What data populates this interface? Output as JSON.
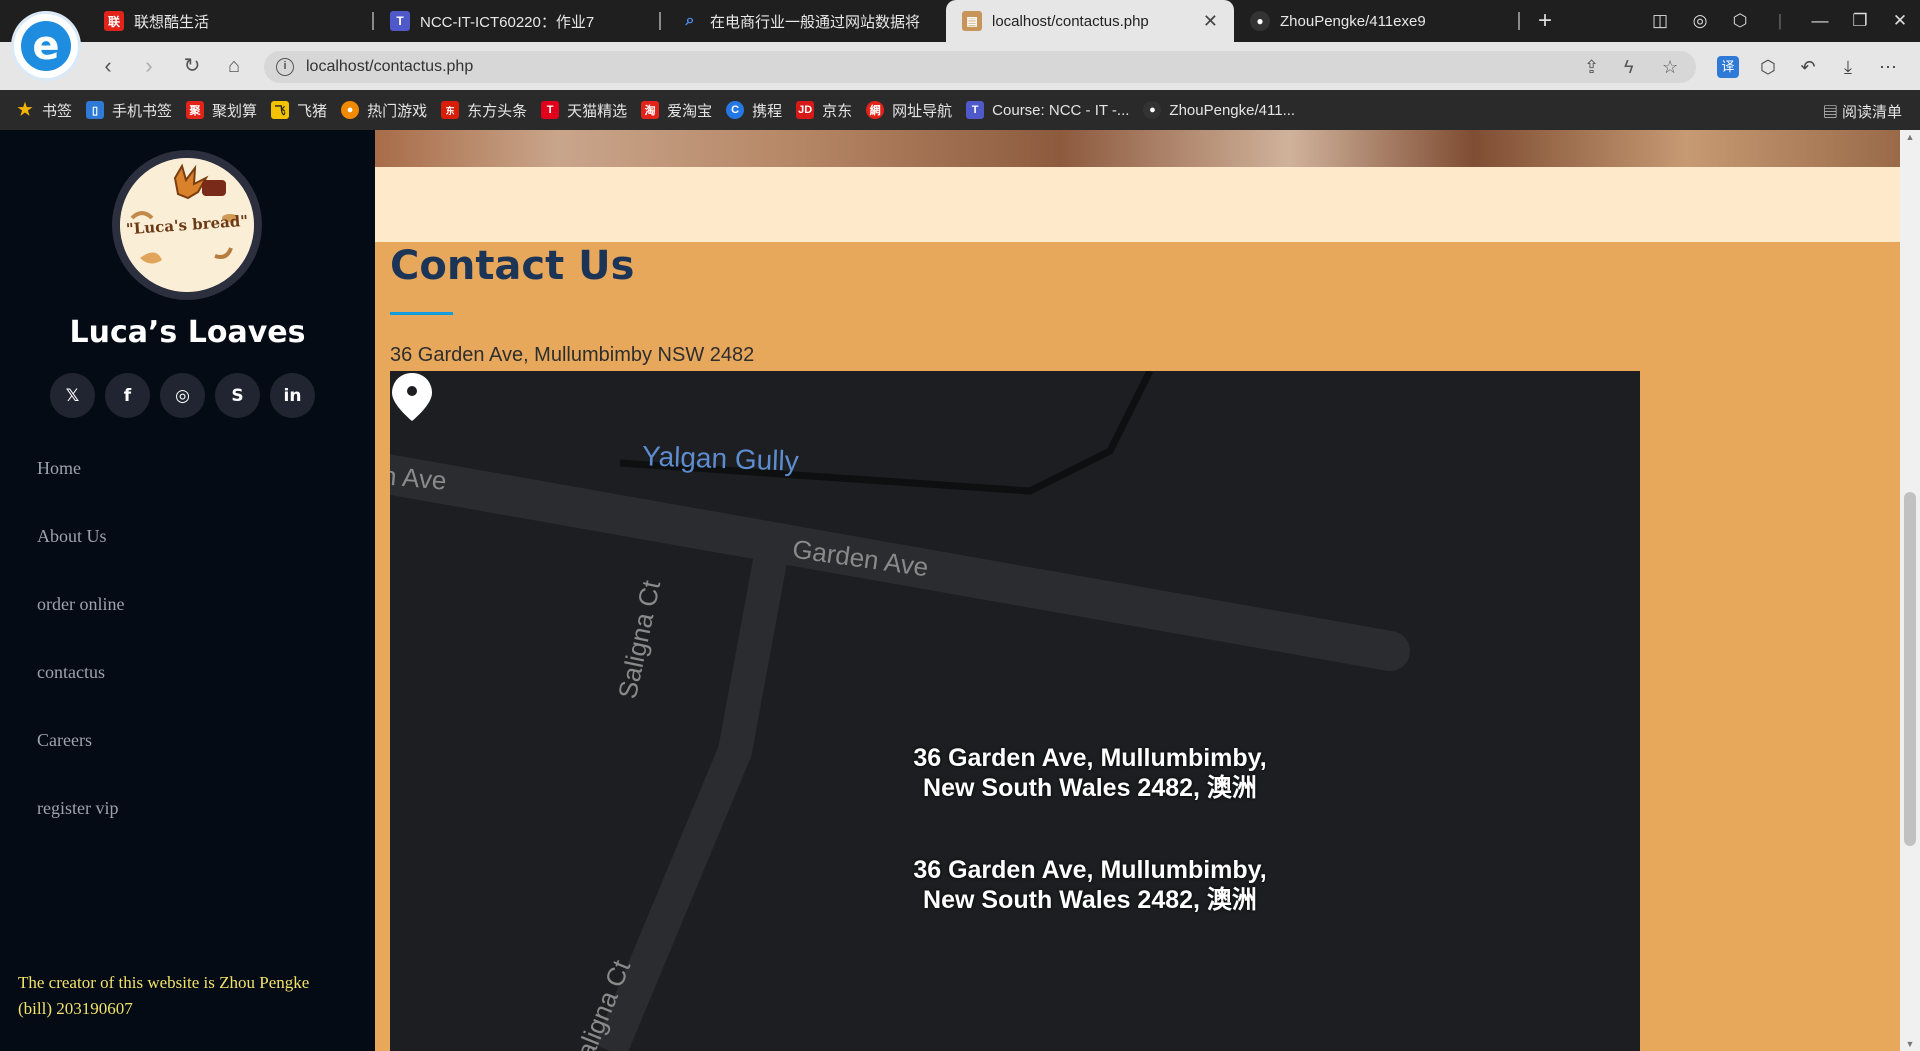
{
  "browser": {
    "tabs": [
      {
        "title": "联想酷生活",
        "icon_name": "lenovo-icon",
        "color": "#e2231a"
      },
      {
        "title": "NCC-IT-ICT60220：作业7",
        "icon_name": "teams-icon",
        "color": "#5059c9"
      },
      {
        "title": "在电商行业一般通过网站数据将",
        "icon_name": "search-icon",
        "color": "#2b6de0"
      },
      {
        "title": "localhost/contactus.php",
        "icon_name": "page-icon",
        "color": "#c7945a"
      },
      {
        "title": "ZhouPengke/411exe9",
        "icon_name": "github-icon",
        "color": "#333333"
      }
    ],
    "url": "localhost/contactus.php",
    "bookmarks": [
      {
        "label": "书签",
        "icon_name": "star-icon",
        "color": "#f5b400"
      },
      {
        "label": "手机书签",
        "icon_name": "phone-icon",
        "color": "#2f7ad6"
      },
      {
        "label": "聚划算",
        "icon_name": "juhuasuan-icon",
        "color": "#e2231a"
      },
      {
        "label": "飞猪",
        "icon_name": "fliggy-icon",
        "color": "#f3c300"
      },
      {
        "label": "热门游戏",
        "icon_name": "game-icon",
        "color": "#f08a00"
      },
      {
        "label": "东方头条",
        "icon_name": "dongfang-icon",
        "color": "#d81e06"
      },
      {
        "label": "天猫精选",
        "icon_name": "tmall-icon",
        "color": "#e2001a"
      },
      {
        "label": "爱淘宝",
        "icon_name": "taobao-icon",
        "color": "#e2231a"
      },
      {
        "label": "携程",
        "icon_name": "ctrip-icon",
        "color": "#2577e3"
      },
      {
        "label": "京东",
        "icon_name": "jd-icon",
        "color": "#d71a18"
      },
      {
        "label": "网址导航",
        "icon_name": "nav-icon",
        "color": "#e2231a"
      },
      {
        "label": "Course: NCC - IT -...",
        "icon_name": "teams-icon",
        "color": "#5059c9"
      },
      {
        "label": "ZhouPengke/411...",
        "icon_name": "github-icon",
        "color": "#333333"
      }
    ],
    "reading_list": "阅读清单"
  },
  "sidebar": {
    "logo_text": "\"Luca's bread\"",
    "brand": "Luca’s Loaves",
    "social": [
      {
        "name": "twitter-icon",
        "glyph": "𝕏"
      },
      {
        "name": "facebook-icon",
        "glyph": "f"
      },
      {
        "name": "instagram-icon",
        "glyph": "◎"
      },
      {
        "name": "skype-icon",
        "glyph": "S"
      },
      {
        "name": "linkedin-icon",
        "glyph": "in"
      }
    ],
    "menu": [
      "Home",
      "About Us",
      "order online",
      "contactus",
      "Careers",
      "register vip"
    ],
    "credit": "The creator of this website is Zhou Pengke (bill) 203190607"
  },
  "main": {
    "heading": "Contact Us",
    "address": "36 Garden Ave, Mullumbimby NSW 2482",
    "map": {
      "streets": [
        "Yalgan Gully",
        "Garden Ave",
        "Saligna Ct"
      ],
      "street_fragment_ave": "n Ave",
      "street_fragment_saligna": "aligna Ct",
      "pin_label_line1": "36 Garden Ave, Mullumbimby,",
      "pin_label_line2": "New South Wales 2482, 澳洲"
    }
  },
  "colors": {
    "sidebar_bg": "#040b14",
    "content_bg": "#e8a85c",
    "accent": "#149ddd",
    "heading": "#1c3557",
    "cream": "#feeacb"
  }
}
